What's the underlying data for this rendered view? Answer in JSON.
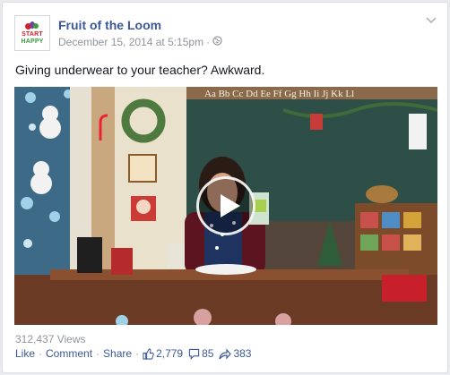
{
  "post": {
    "page_name": "Fruit of the Loom",
    "timestamp": "December 15, 2014 at 5:15pm",
    "timestamp_separator": "·",
    "audience_icon": "globe-icon",
    "message": "Giving underwear to your teacher? Awkward.",
    "avatar": {
      "line1": "START",
      "line2": "HAPPY"
    }
  },
  "video": {
    "play_icon": "play-icon",
    "chalkboard_text": "Aa Bb Cc Dd Ee Ff Gg Hh Ii Jj Kk Ll"
  },
  "footer": {
    "views": "312,437 Views",
    "like_label": "Like",
    "comment_label": "Comment",
    "share_label": "Share",
    "separator": "·",
    "likes_count": "2,779",
    "comments_count": "85",
    "shares_count": "383"
  },
  "colors": {
    "link": "#3b5998",
    "meta": "#90949c",
    "text": "#141823"
  }
}
